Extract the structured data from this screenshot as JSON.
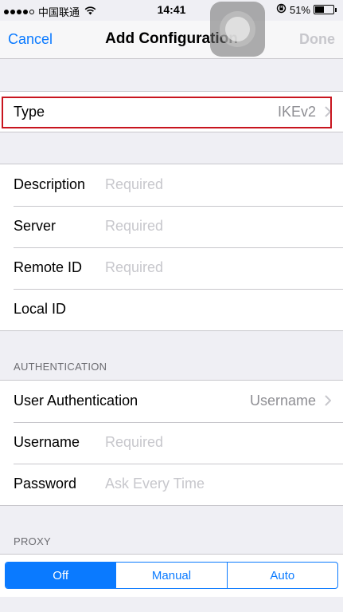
{
  "status_bar": {
    "carrier": "中国联通",
    "time": "14:41",
    "battery": "51%",
    "battery_level": 0.51
  },
  "nav": {
    "cancel_label": "Cancel",
    "title": "Add Configuration",
    "done_label": "Done"
  },
  "type_row": {
    "label": "Type",
    "value": "IKEv2"
  },
  "details": {
    "description_label": "Description",
    "description_placeholder": "Required",
    "server_label": "Server",
    "server_placeholder": "Required",
    "remote_id_label": "Remote ID",
    "remote_id_placeholder": "Required",
    "local_id_label": "Local ID"
  },
  "authentication": {
    "header": "AUTHENTICATION",
    "user_auth_label": "User Authentication",
    "user_auth_value": "Username",
    "username_label": "Username",
    "username_placeholder": "Required",
    "password_label": "Password",
    "password_placeholder": "Ask Every Time"
  },
  "proxy": {
    "header": "PROXY",
    "options": [
      "Off",
      "Manual",
      "Auto"
    ],
    "selected": "Off"
  },
  "colors": {
    "accent": "#0a7aff",
    "highlight_border": "#c8141e"
  }
}
